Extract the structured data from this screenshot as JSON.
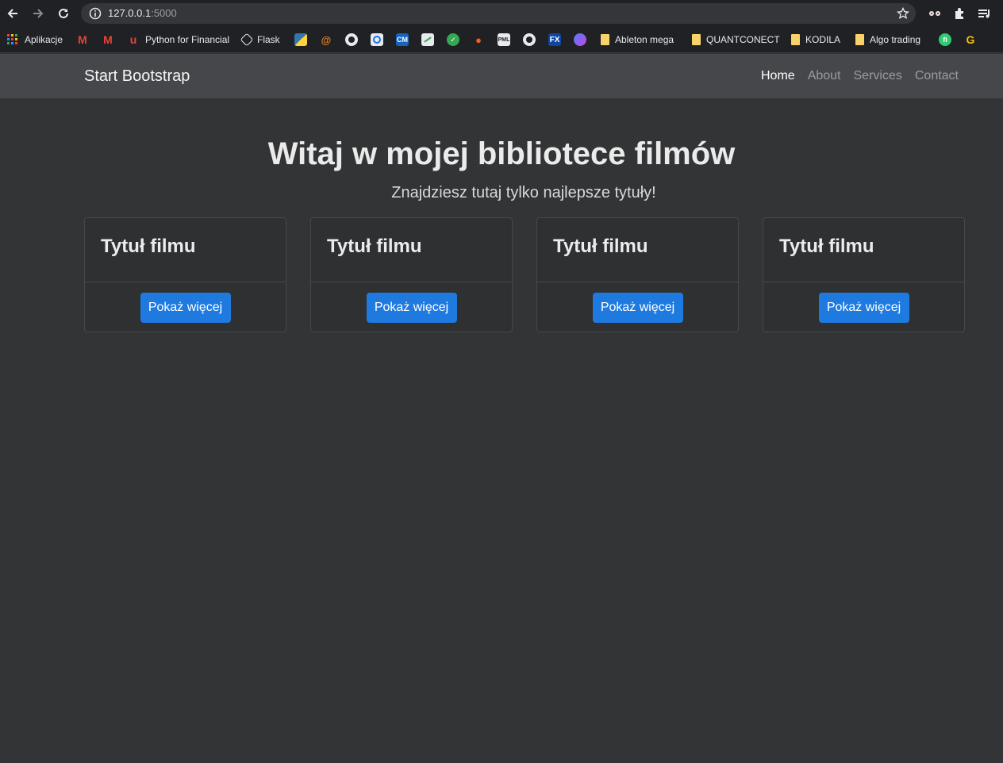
{
  "browser": {
    "url_host": "127.0.0.1",
    "url_port": ":5000"
  },
  "bookmarks": {
    "apps": "Aplikacje",
    "python_financial": "Python for Financial",
    "flask": "Flask",
    "ableton": "Ableton mega",
    "quantconnect": "QUANTCONECT",
    "kodila": "KODILA",
    "algo": "Algo trading"
  },
  "nav": {
    "brand": "Start Bootstrap",
    "links": [
      "Home",
      "About",
      "Services",
      "Contact"
    ]
  },
  "hero": {
    "title": "Witaj w mojej bibliotece filmów",
    "subtitle": "Znajdziesz tutaj tylko najlepsze tytuły!"
  },
  "cards": [
    {
      "title": "Tytuł filmu",
      "button": "Pokaż więcej"
    },
    {
      "title": "Tytuł filmu",
      "button": "Pokaż więcej"
    },
    {
      "title": "Tytuł filmu",
      "button": "Pokaż więcej"
    },
    {
      "title": "Tytuł filmu",
      "button": "Pokaż więcej"
    }
  ],
  "colors": {
    "page_bg": "#333436",
    "navbar_bg": "#45474a",
    "button": "#1f7ae0"
  }
}
